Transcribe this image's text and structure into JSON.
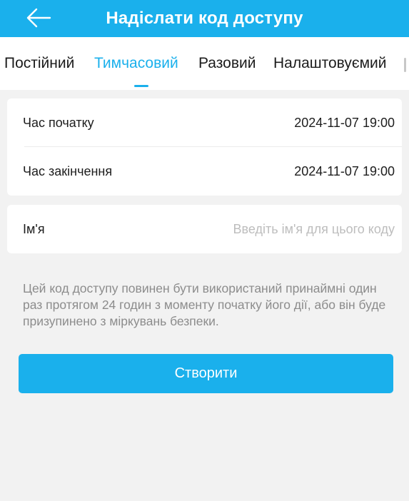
{
  "header": {
    "title": "Надіслати код доступу",
    "back_icon": "arrow-left-icon"
  },
  "tabs": [
    {
      "label": "Постійний",
      "active": false
    },
    {
      "label": "Тимчасовий",
      "active": true
    },
    {
      "label": "Разовий",
      "active": false
    },
    {
      "label": "Налаштовуємий",
      "active": false
    }
  ],
  "time_card": {
    "start": {
      "label": "Час початку",
      "value": "2024-11-07 19:00"
    },
    "end": {
      "label": "Час закінчення",
      "value": "2024-11-07 19:00"
    }
  },
  "name_card": {
    "label": "Ім'я",
    "placeholder": "Введіть ім'я для цього коду",
    "value": ""
  },
  "note": "Цей код доступу повинен бути використаний принаймні один раз протягом 24 годин з моменту початку його дії, або він буде призупинено з міркувань безпеки.",
  "create_button": {
    "label": "Створити"
  },
  "colors": {
    "accent": "#1ab0ec",
    "background": "#f2f2f2",
    "card": "#ffffff",
    "note_text": "#8c8c8c",
    "placeholder": "#bdbdbd"
  }
}
